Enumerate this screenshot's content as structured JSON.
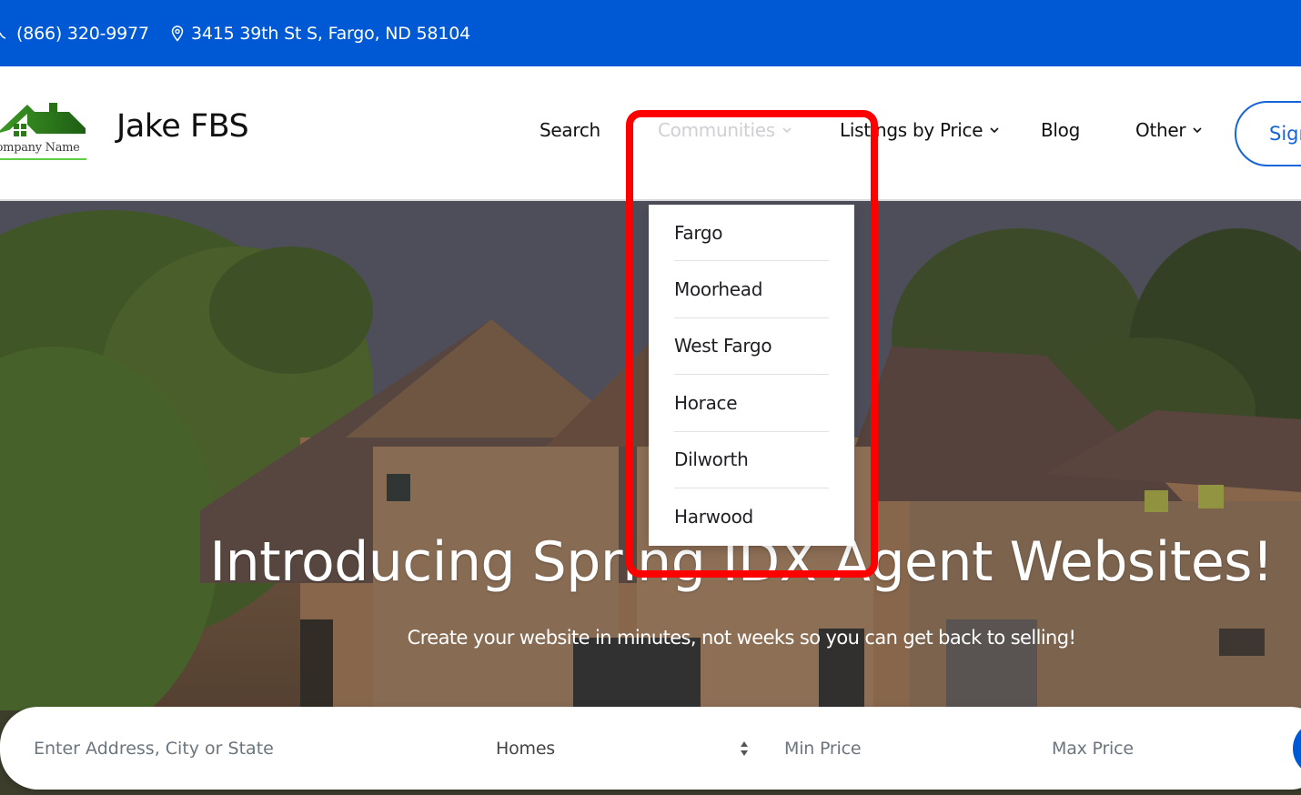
{
  "topbar": {
    "phone": "(866) 320-9977",
    "phone_icon": "phone-icon",
    "address": "3415 39th St S, Fargo, ND 58104",
    "address_icon": "map-pin-icon",
    "background": "#0059d4"
  },
  "header": {
    "logo_caption": "Company Name",
    "brand": "Jake FBS",
    "nav": [
      {
        "label": "Search",
        "has_dropdown": false
      },
      {
        "label": "Communities",
        "has_dropdown": true,
        "active": true
      },
      {
        "label": "Listings by Price",
        "has_dropdown": true
      },
      {
        "label": "Blog",
        "has_dropdown": false
      },
      {
        "label": "Other",
        "has_dropdown": true
      }
    ],
    "signin_label": "Sign In"
  },
  "communities_dropdown": {
    "items": [
      "Fargo",
      "Moorhead",
      "West Fargo",
      "Horace",
      "Dilworth",
      "Harwood"
    ]
  },
  "hero": {
    "title": "Introducing Spring IDX Agent Websites!",
    "subtitle": "Create your website in minutes, not weeks so you can get back to selling!"
  },
  "search": {
    "address_placeholder": "Enter Address, City or State",
    "address_value": "",
    "property_type": "Homes",
    "min_price_placeholder": "Min Price",
    "max_price_placeholder": "Max Price",
    "submit_icon": "search-icon"
  },
  "colors": {
    "primary": "#0059d4",
    "highlight": "#ff0000",
    "logo_green": "#2d7a1c"
  }
}
